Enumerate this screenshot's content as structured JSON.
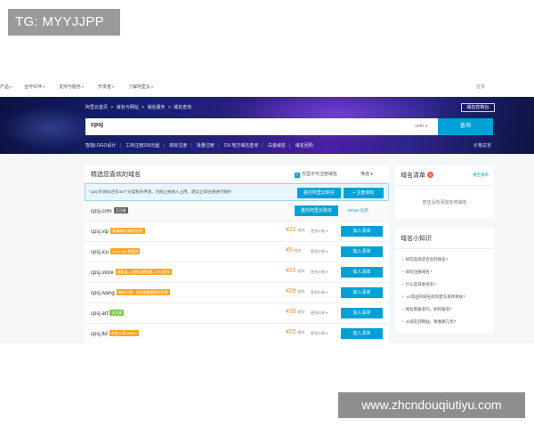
{
  "watermark_top": "TG: MYYJJPP",
  "watermark_bottom": "www.zhcndouqiutiyu.com",
  "topnav": {
    "items": [
      "产品",
      "合作伙伴",
      "支持与服务",
      "开发者",
      "了解阿里云"
    ],
    "login": "登录"
  },
  "hero": {
    "breadcrumb": [
      "阿里云首页",
      ">",
      "域名与网站",
      ">",
      "域名服务",
      ">",
      "域名查询"
    ],
    "manage_button": "域名控制台",
    "search_query": "cpsj",
    "suffix": ".com",
    "search_button": "查询",
    "quick_links": [
      "智能LOGO设计",
      "工商注册299元起",
      "商标注册",
      "批量注册",
      "CN 地方域名查询",
      "白金域名",
      "域名回购"
    ],
    "price_link": "价格总览"
  },
  "list": {
    "title": "精选您喜欢的域名",
    "only_registrable": "仅显示可注册域名",
    "filter": "筛选",
    "notice": {
      "text": "“cpsj”的商标还有45个分类暂未申请，为防止被他人占用，建议立即注册进行保护",
      "consign_button": "委托阿里云购买",
      "trademark_button": "注册商标"
    },
    "rows": [
      {
        "domain": "cpsj.com",
        "badge": "已注册",
        "badge_color": "#666666",
        "status": "taken",
        "buy_label": "委托阿里云购买",
        "whois": "Whois 信息"
      },
      {
        "domain": "cpsj.vip",
        "badge": "高端商标“邮政专用”",
        "badge_color": "#f5a623",
        "status": "free",
        "price": "¥22",
        "price_unit": "/首年",
        "more": "更多价格",
        "add_label": "加入清单"
      },
      {
        "domain": "cpsj.icu",
        "badge": "I see you,我爱你",
        "badge_color": "#f5a623",
        "status": "free",
        "price": "¥9",
        "price_unit": "/首年",
        "more": "更多价格",
        "add_label": "加入清单"
      },
      {
        "domain": "cpsj.store",
        "badge": "星级店—全新品牌优惠，8元/首年",
        "badge_color": "#f5a623",
        "status": "free",
        "price": "¥15",
        "price_unit": "/首年",
        "more": "更多价格",
        "add_label": "加入清单"
      },
      {
        "domain": "cpsj.wang",
        "badge": "每年小网，你这是最爱呢的品牌",
        "badge_color": "#f5a623",
        "status": "free",
        "price": "¥29",
        "price_unit": "/首年",
        "more": "更多价格",
        "add_label": "加入清单"
      },
      {
        "domain": "cpsj.art",
        "badge": "艺术家",
        "badge_color": "#7ac943",
        "status": "free",
        "price": "¥39",
        "price_unit": "/首年",
        "more": "更多价格",
        "add_label": "加入清单"
      },
      {
        "domain": "cpsj.ltd",
        "badge": "有限公司Limited",
        "badge_color": "#f5a623",
        "status": "free",
        "price": "¥20",
        "price_unit": "/首年",
        "more": "更多价格",
        "add_label": "加入清单"
      }
    ]
  },
  "cart": {
    "title": "域名清单",
    "count": "0",
    "clear": "清空清单",
    "empty": "您还没有添加任何域名"
  },
  "tips": {
    "title": "域名小知识",
    "items": [
      "如何选择适合您的域名?",
      "如何注册域名?",
      "什么是白金域名?",
      ".cn等国内域名如何建交易转审核?",
      "域名看备案吗，如何备案?",
      "从域名到网站，要做哪几步?"
    ]
  },
  "colors": {
    "accent": "#00a1d6",
    "price": "#f68f19",
    "hero_dark": "#14206e"
  }
}
